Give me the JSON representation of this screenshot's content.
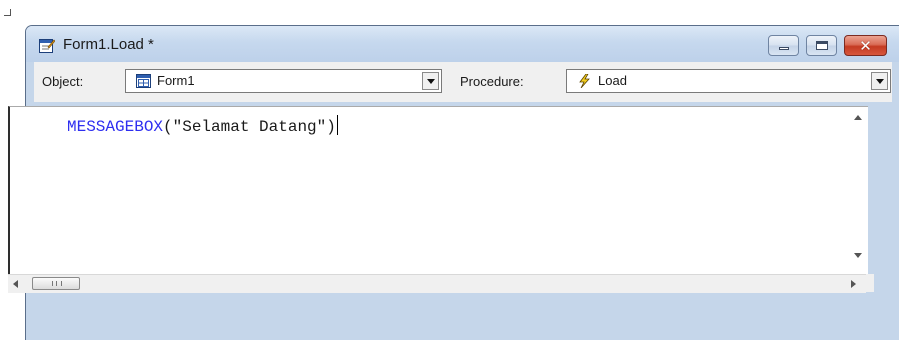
{
  "window": {
    "title": "Form1.Load *",
    "close_glyph": "✕"
  },
  "selectors": {
    "object_label": "Object:",
    "object_value": "Form1",
    "object_icon": "form-grid-icon",
    "procedure_label": "Procedure:",
    "procedure_value": "Load",
    "procedure_icon": "lightning-icon"
  },
  "editor": {
    "keyword": "MESSAGEBOX",
    "arguments": "(\"Selamat Datang\")"
  },
  "colors": {
    "keyword": "#2e2ef0",
    "close_button": "#c43a22",
    "window_frame": "#c5d6ea"
  },
  "icons": {
    "title": "form-edit-icon",
    "minimize": "minimize-icon",
    "maximize": "maximize-icon",
    "close": "close-icon"
  }
}
